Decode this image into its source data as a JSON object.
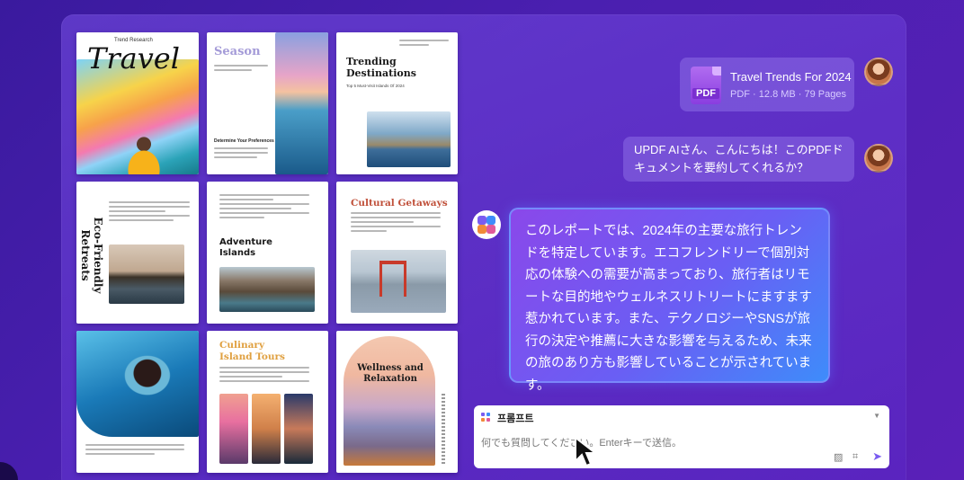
{
  "pages": {
    "travel": {
      "kicker": "Trend Research",
      "title": "Travel"
    },
    "season": {
      "title": "Season",
      "section": "Determine Your Preferences"
    },
    "trending": {
      "title": "Trending Destinations",
      "subtitle": "Top 5 Must-Visit Islands Of 2024"
    },
    "eco": {
      "title": "Eco-Friendly Retreats"
    },
    "adventure": {
      "title": "Adventure Islands"
    },
    "cultural": {
      "title": "Cultural Getaways"
    },
    "culinary": {
      "title_line1": "Culinary",
      "title_line2": "Island Tours"
    },
    "wellness": {
      "title": "Wellness and Relaxation"
    }
  },
  "file": {
    "name": "Travel Trends For 2024",
    "meta": "PDF · 12.8 MB · 79 Pages",
    "icon_label": "PDF"
  },
  "user_message": "UPDF AIさん、こんにちは！このPDFドキュメントを要約してくれるか？",
  "ai_message": "このレポートでは、2024年の主要な旅行トレンドを特定しています。エコフレンドリーで個別対応の体験への需要が高まっており、旅行者はリモートな目的地やウェルネスリトリートにますます惹かれています。また、テクノロジーやSNSが旅行の決定や推薦に大きな影響を与えるため、未来の旅のあり方も影響していることが示されています。",
  "input": {
    "prompt_label": "프롬프트",
    "placeholder": "何でも質問してください。Enterキーで送信。"
  },
  "colors": {
    "accent": "#7a5cf0",
    "bubble_start": "#8a48ea",
    "bubble_end": "#3e8cfa"
  },
  "icons": [
    "pdf-icon",
    "avatar",
    "updf-ai-logo",
    "prompt-icon",
    "chevron-down-icon",
    "image-icon",
    "crop-icon",
    "send-icon"
  ]
}
